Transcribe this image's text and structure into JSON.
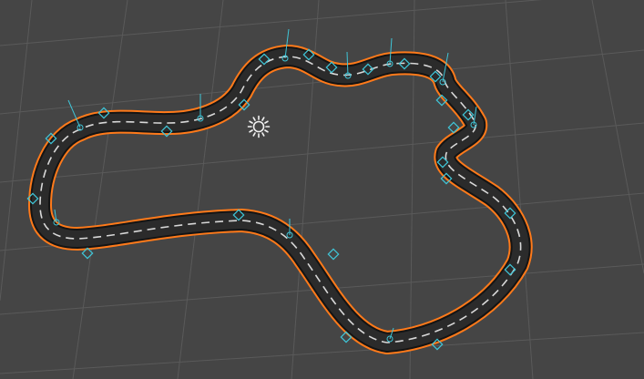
{
  "viewport": {
    "background": "#454545",
    "grid_color": "#5a5a5a",
    "grid_visible": true
  },
  "scene": {
    "light": {
      "icon": "sun-light-icon",
      "color": "#f2f2f2"
    },
    "track": {
      "outline_color": "#ff7a1a",
      "road_color": "#2b2b2b",
      "lane_marking_color": "#d8d8d8",
      "selected": true
    },
    "gizmo_color": "#3fc6d8"
  }
}
